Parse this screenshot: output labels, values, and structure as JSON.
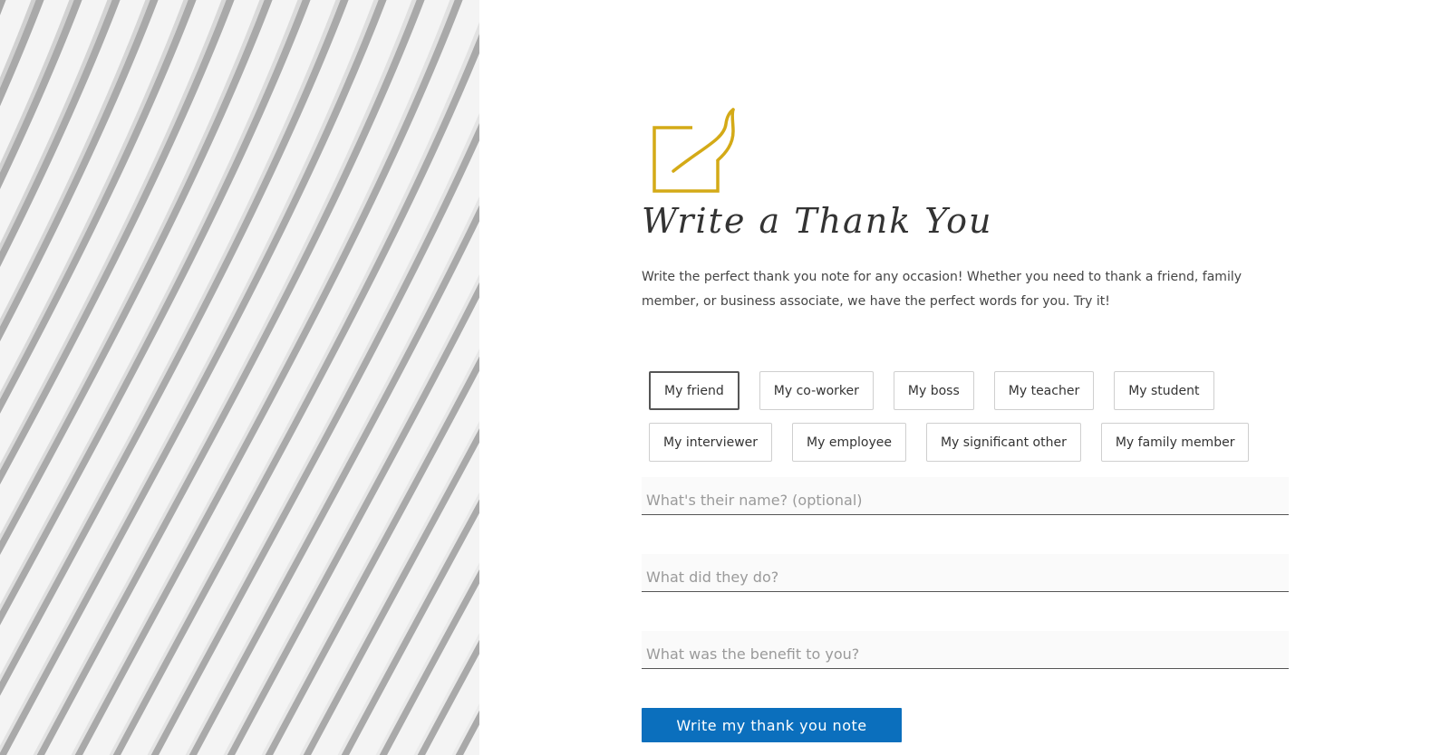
{
  "hero": {
    "logo_icon": "note-pen-icon",
    "logo_color": "#d4aa17",
    "title": "Write a Thank You",
    "description": "Write the perfect thank you note for any occasion! Whether you need to thank a friend, family member, or business associate, we have the perfect words for you. Try it!"
  },
  "recipients": {
    "selected": "My friend",
    "rows": [
      [
        "My friend",
        "My co-worker",
        "My boss",
        "My teacher",
        "My student"
      ],
      [
        "My interviewer",
        "My employee",
        "My significant other",
        "My family member"
      ]
    ]
  },
  "form": {
    "name_placeholder": "What's their name? (optional)",
    "name_value": "",
    "did_placeholder": "What did they do?",
    "did_value": "",
    "benefit_placeholder": "What was the benefit to you?",
    "benefit_value": "",
    "submit_label": "Write my thank you note",
    "submit_color": "#0b6fbd"
  }
}
